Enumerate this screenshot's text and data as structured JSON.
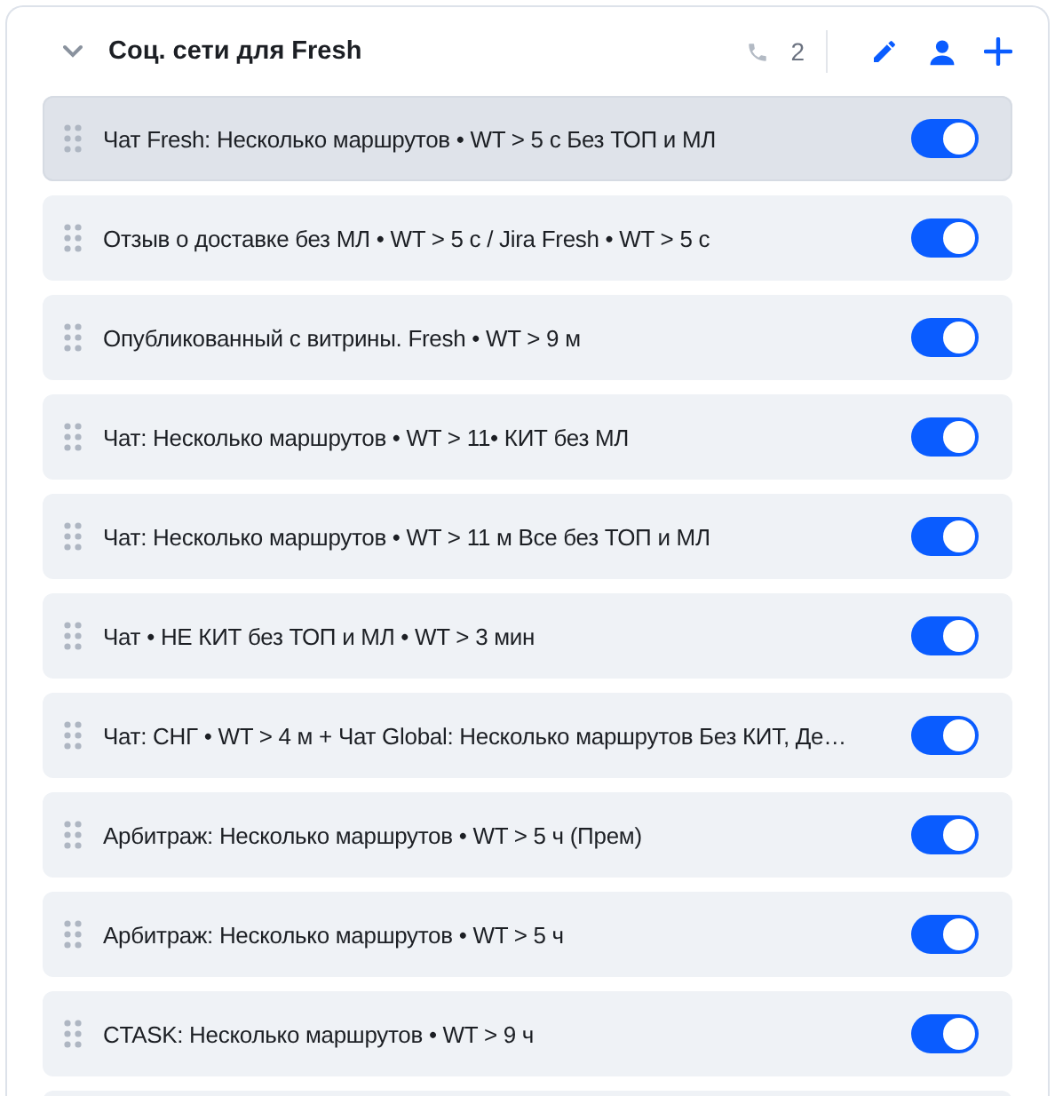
{
  "group": {
    "title": "Соц. сети для Fresh",
    "expanded": true,
    "phone_count": "2"
  },
  "rules": [
    {
      "label": "Чат Fresh: Несколько маршрутов • WT > 5 с Без ТОП и МЛ",
      "on": true,
      "selected": true
    },
    {
      "label": "Отзыв о доставке без МЛ • WT > 5 с / Jira Fresh • WT > 5 с",
      "on": true,
      "selected": false
    },
    {
      "label": "Опубликованный с витрины. Fresh • WT > 9 м",
      "on": true,
      "selected": false
    },
    {
      "label": "Чат: Несколько маршрутов • WT > 11• КИТ без МЛ",
      "on": true,
      "selected": false
    },
    {
      "label": "Чат: Несколько маршрутов • WT > 11 м Все без ТОП и МЛ",
      "on": true,
      "selected": false
    },
    {
      "label": "Чат • НЕ КИТ без ТОП и МЛ • WT > 3 мин",
      "on": true,
      "selected": false
    },
    {
      "label": "Чат: СНГ • WT > 4 м + Чат Global: Несколько маршрутов Без КИТ, Де…",
      "on": true,
      "selected": false
    },
    {
      "label": "Арбитраж: Несколько маршрутов • WT > 5 ч (Прем)",
      "on": true,
      "selected": false
    },
    {
      "label": "Арбитраж: Несколько маршрутов • WT > 5 ч",
      "on": true,
      "selected": false
    },
    {
      "label": "CTASK: Несколько маршрутов • WT > 9 ч",
      "on": true,
      "selected": false
    }
  ]
}
